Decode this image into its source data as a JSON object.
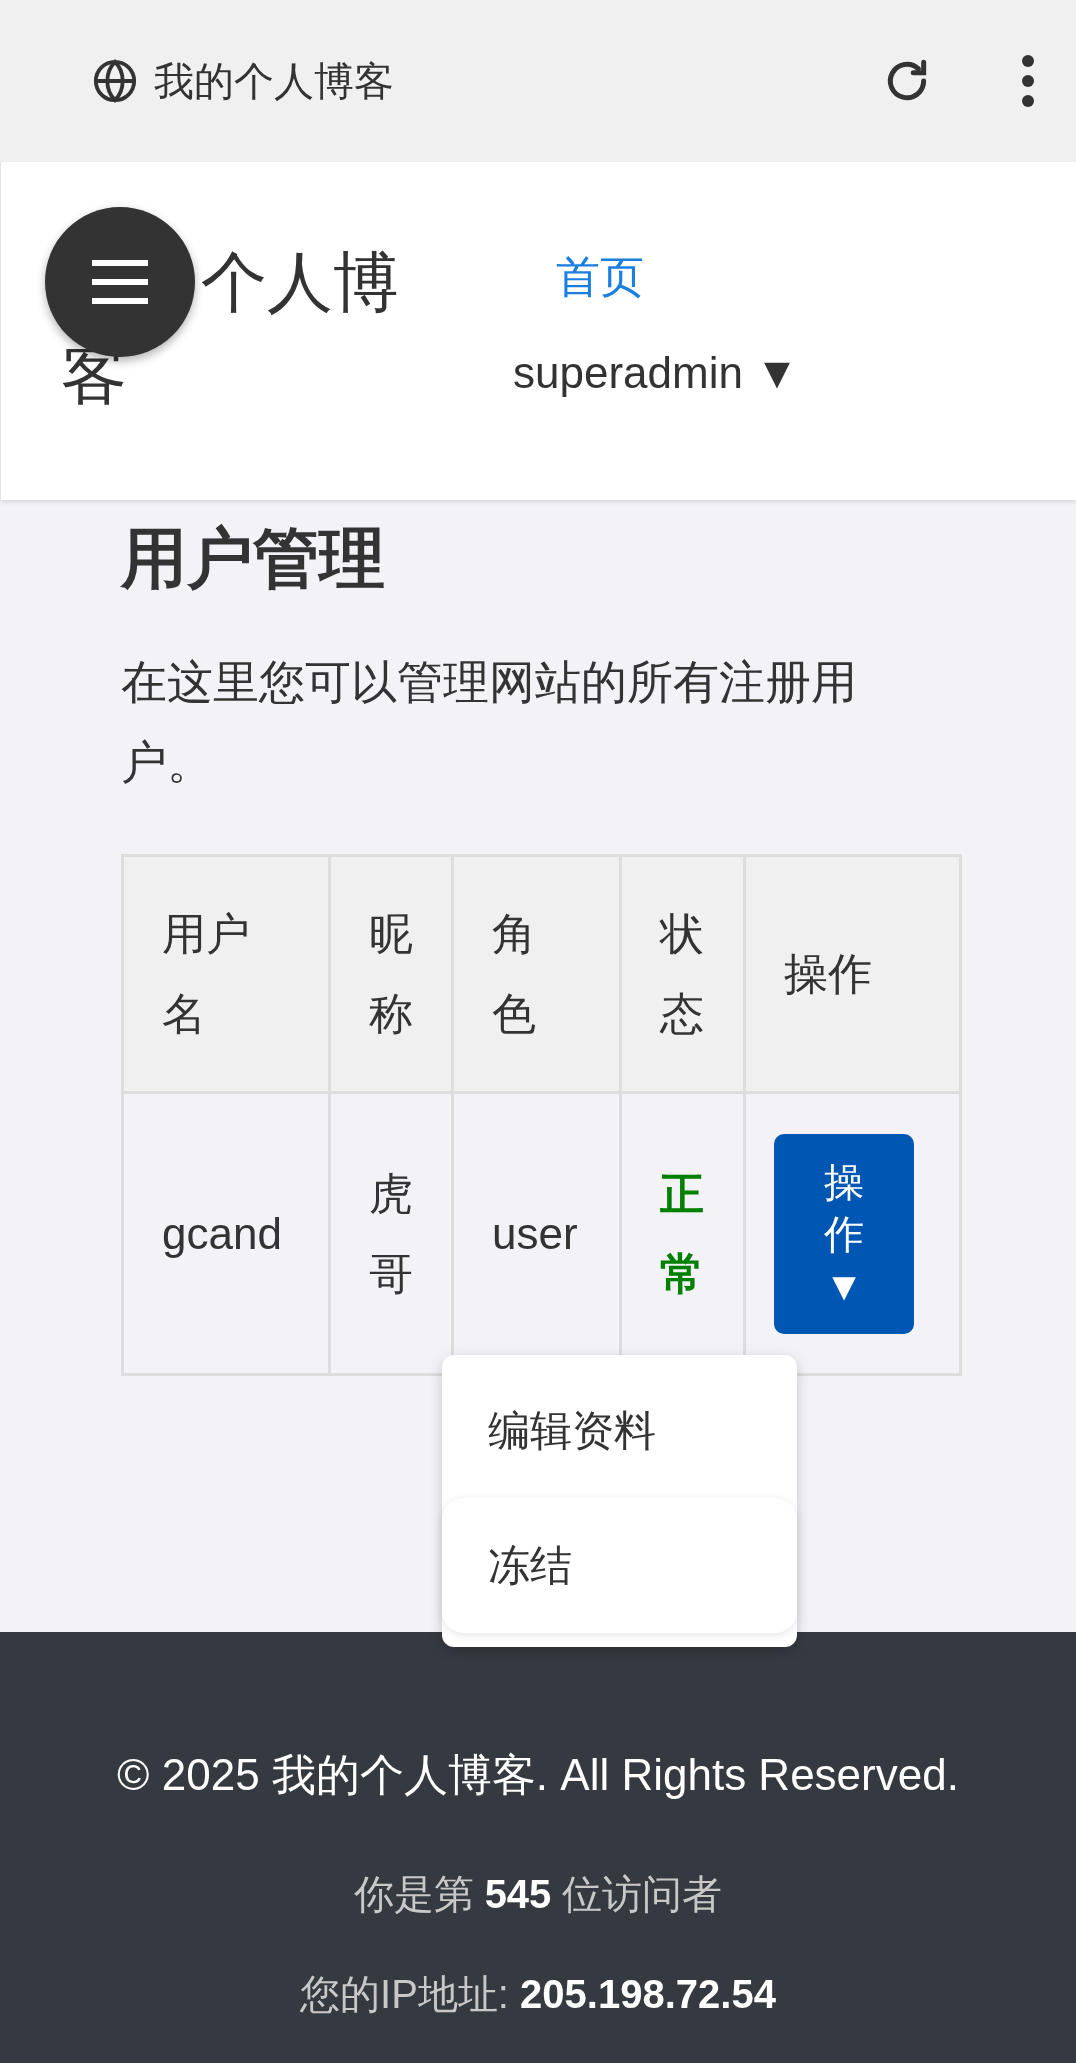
{
  "browser": {
    "title": "我的个人博客"
  },
  "header": {
    "site_title": "个人博客",
    "nav": [
      {
        "label": "首页",
        "kind": "link"
      },
      {
        "label": "superadmin ▼",
        "kind": "user"
      }
    ]
  },
  "page": {
    "heading": "用户管理",
    "description": "在这里您可以管理网站的所有注册用户。"
  },
  "table": {
    "columns": [
      "用户名",
      "昵称",
      "角色",
      "状态",
      "操作"
    ],
    "rows": [
      {
        "username": "gcand",
        "nickname": "虎哥",
        "role": "user",
        "status": "正常",
        "color": "#008000",
        "action": "操作",
        "action_caret": "▼"
      }
    ]
  },
  "dropdown": {
    "items": [
      {
        "label": "编辑资料",
        "highlighted": false
      },
      {
        "label": "冻结",
        "highlighted": true
      }
    ]
  },
  "footer": {
    "copyright": "© 2025 我的个人博客. All Rights Reserved.",
    "visitors": "你是第 **545** 位访问者",
    "ip": "您的IP地址: **205.198.72.54**"
  }
}
